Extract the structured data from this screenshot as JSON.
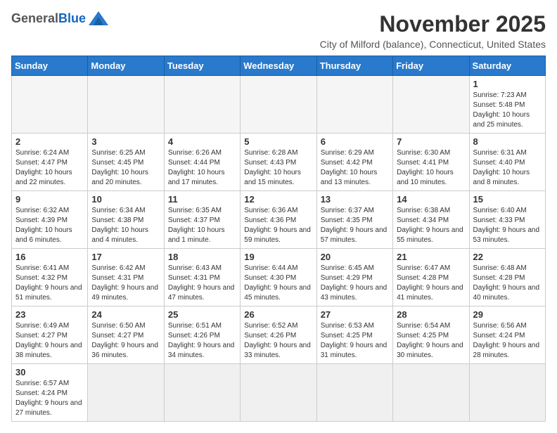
{
  "header": {
    "logo_general": "General",
    "logo_blue": "Blue",
    "month": "November 2025",
    "subtitle": "City of Milford (balance), Connecticut, United States"
  },
  "weekdays": [
    "Sunday",
    "Monday",
    "Tuesday",
    "Wednesday",
    "Thursday",
    "Friday",
    "Saturday"
  ],
  "weeks": [
    [
      {
        "day": "",
        "info": ""
      },
      {
        "day": "",
        "info": ""
      },
      {
        "day": "",
        "info": ""
      },
      {
        "day": "",
        "info": ""
      },
      {
        "day": "",
        "info": ""
      },
      {
        "day": "",
        "info": ""
      },
      {
        "day": "1",
        "info": "Sunrise: 7:23 AM\nSunset: 5:48 PM\nDaylight: 10 hours and 25 minutes."
      }
    ],
    [
      {
        "day": "2",
        "info": "Sunrise: 6:24 AM\nSunset: 4:47 PM\nDaylight: 10 hours and 22 minutes."
      },
      {
        "day": "3",
        "info": "Sunrise: 6:25 AM\nSunset: 4:45 PM\nDaylight: 10 hours and 20 minutes."
      },
      {
        "day": "4",
        "info": "Sunrise: 6:26 AM\nSunset: 4:44 PM\nDaylight: 10 hours and 17 minutes."
      },
      {
        "day": "5",
        "info": "Sunrise: 6:28 AM\nSunset: 4:43 PM\nDaylight: 10 hours and 15 minutes."
      },
      {
        "day": "6",
        "info": "Sunrise: 6:29 AM\nSunset: 4:42 PM\nDaylight: 10 hours and 13 minutes."
      },
      {
        "day": "7",
        "info": "Sunrise: 6:30 AM\nSunset: 4:41 PM\nDaylight: 10 hours and 10 minutes."
      },
      {
        "day": "8",
        "info": "Sunrise: 6:31 AM\nSunset: 4:40 PM\nDaylight: 10 hours and 8 minutes."
      }
    ],
    [
      {
        "day": "9",
        "info": "Sunrise: 6:32 AM\nSunset: 4:39 PM\nDaylight: 10 hours and 6 minutes."
      },
      {
        "day": "10",
        "info": "Sunrise: 6:34 AM\nSunset: 4:38 PM\nDaylight: 10 hours and 4 minutes."
      },
      {
        "day": "11",
        "info": "Sunrise: 6:35 AM\nSunset: 4:37 PM\nDaylight: 10 hours and 1 minute."
      },
      {
        "day": "12",
        "info": "Sunrise: 6:36 AM\nSunset: 4:36 PM\nDaylight: 9 hours and 59 minutes."
      },
      {
        "day": "13",
        "info": "Sunrise: 6:37 AM\nSunset: 4:35 PM\nDaylight: 9 hours and 57 minutes."
      },
      {
        "day": "14",
        "info": "Sunrise: 6:38 AM\nSunset: 4:34 PM\nDaylight: 9 hours and 55 minutes."
      },
      {
        "day": "15",
        "info": "Sunrise: 6:40 AM\nSunset: 4:33 PM\nDaylight: 9 hours and 53 minutes."
      }
    ],
    [
      {
        "day": "16",
        "info": "Sunrise: 6:41 AM\nSunset: 4:32 PM\nDaylight: 9 hours and 51 minutes."
      },
      {
        "day": "17",
        "info": "Sunrise: 6:42 AM\nSunset: 4:31 PM\nDaylight: 9 hours and 49 minutes."
      },
      {
        "day": "18",
        "info": "Sunrise: 6:43 AM\nSunset: 4:31 PM\nDaylight: 9 hours and 47 minutes."
      },
      {
        "day": "19",
        "info": "Sunrise: 6:44 AM\nSunset: 4:30 PM\nDaylight: 9 hours and 45 minutes."
      },
      {
        "day": "20",
        "info": "Sunrise: 6:45 AM\nSunset: 4:29 PM\nDaylight: 9 hours and 43 minutes."
      },
      {
        "day": "21",
        "info": "Sunrise: 6:47 AM\nSunset: 4:28 PM\nDaylight: 9 hours and 41 minutes."
      },
      {
        "day": "22",
        "info": "Sunrise: 6:48 AM\nSunset: 4:28 PM\nDaylight: 9 hours and 40 minutes."
      }
    ],
    [
      {
        "day": "23",
        "info": "Sunrise: 6:49 AM\nSunset: 4:27 PM\nDaylight: 9 hours and 38 minutes."
      },
      {
        "day": "24",
        "info": "Sunrise: 6:50 AM\nSunset: 4:27 PM\nDaylight: 9 hours and 36 minutes."
      },
      {
        "day": "25",
        "info": "Sunrise: 6:51 AM\nSunset: 4:26 PM\nDaylight: 9 hours and 34 minutes."
      },
      {
        "day": "26",
        "info": "Sunrise: 6:52 AM\nSunset: 4:26 PM\nDaylight: 9 hours and 33 minutes."
      },
      {
        "day": "27",
        "info": "Sunrise: 6:53 AM\nSunset: 4:25 PM\nDaylight: 9 hours and 31 minutes."
      },
      {
        "day": "28",
        "info": "Sunrise: 6:54 AM\nSunset: 4:25 PM\nDaylight: 9 hours and 30 minutes."
      },
      {
        "day": "29",
        "info": "Sunrise: 6:56 AM\nSunset: 4:24 PM\nDaylight: 9 hours and 28 minutes."
      }
    ],
    [
      {
        "day": "30",
        "info": "Sunrise: 6:57 AM\nSunset: 4:24 PM\nDaylight: 9 hours and 27 minutes."
      },
      {
        "day": "",
        "info": ""
      },
      {
        "day": "",
        "info": ""
      },
      {
        "day": "",
        "info": ""
      },
      {
        "day": "",
        "info": ""
      },
      {
        "day": "",
        "info": ""
      },
      {
        "day": "",
        "info": ""
      }
    ]
  ]
}
